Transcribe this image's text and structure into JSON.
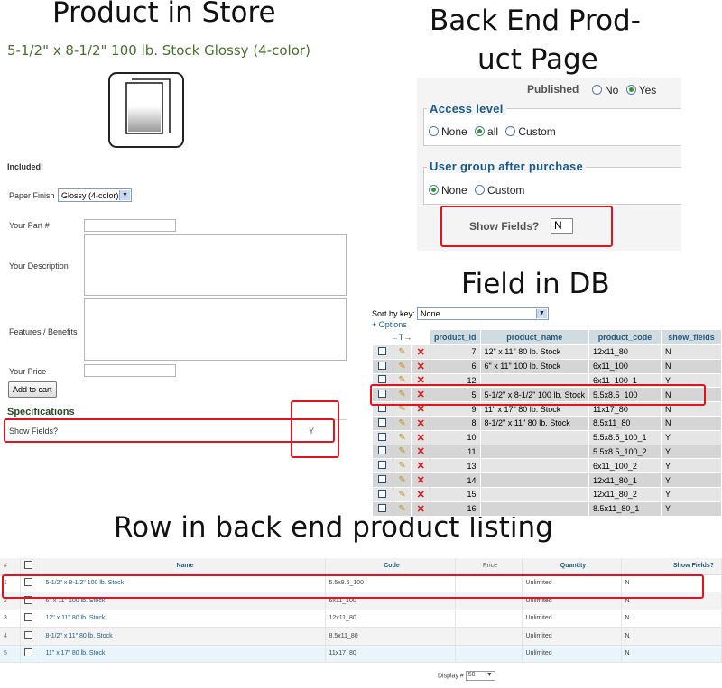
{
  "headings": {
    "store": "Product in Store",
    "backend_line1": "Back End Prod-",
    "backend_line2": "uct Page",
    "db": "Field in DB",
    "listing": "Row in back end product listing"
  },
  "store": {
    "product_title": "5-1/2\" x 8-1/2\" 100 lb. Stock Glossy (4-color)",
    "included": "Included!",
    "paper_finish_label": "Paper Finish",
    "paper_finish_value": "Glossy (4-color)",
    "part_label": "Your Part #",
    "description_label": "Your Description",
    "features_label": "Features / Benefits",
    "price_label": "Your Price",
    "add_to_cart": "Add to cart",
    "specifications": "Specifications",
    "show_fields_label": "Show Fields?",
    "show_fields_value": "Y"
  },
  "backend": {
    "published_label": "Published",
    "no": "No",
    "yes": "Yes",
    "access_level": "Access level",
    "none": "None",
    "all": "all",
    "custom": "Custom",
    "user_group": "User group after purchase",
    "show_fields_label": "Show Fields?",
    "show_fields_value": "N"
  },
  "db": {
    "sort_by_label": "Sort by key:",
    "sort_by_value": "None",
    "options": "+ Options",
    "nav": "←T→",
    "columns": [
      "product_id",
      "product_name",
      "product_code",
      "show_fields"
    ],
    "rows": [
      {
        "id": "7",
        "name": "12\" x 11\" 80 lb. Stock",
        "code": "12x11_80",
        "show": "N"
      },
      {
        "id": "6",
        "name": "6\" x 11\" 100 lb. Stock",
        "code": "6x11_100",
        "show": "N"
      },
      {
        "id": "12",
        "name": "",
        "code": "6x11_100_1",
        "show": "Y"
      },
      {
        "id": "5",
        "name": "5-1/2\" x 8-1/2\" 100 lb. Stock",
        "code": "5.5x8.5_100",
        "show": "N"
      },
      {
        "id": "9",
        "name": "11\" x 17\" 80 lb. Stock",
        "code": "11x17_80",
        "show": "N"
      },
      {
        "id": "8",
        "name": "8-1/2\" x 11\" 80 lb. Stock",
        "code": "8.5x11_80",
        "show": "N"
      },
      {
        "id": "10",
        "name": "",
        "code": "5.5x8.5_100_1",
        "show": "Y"
      },
      {
        "id": "11",
        "name": "",
        "code": "5.5x8.5_100_2",
        "show": "Y"
      },
      {
        "id": "13",
        "name": "",
        "code": "6x11_100_2",
        "show": "Y"
      },
      {
        "id": "14",
        "name": "",
        "code": "12x11_80_1",
        "show": "Y"
      },
      {
        "id": "15",
        "name": "",
        "code": "12x11_80_2",
        "show": "Y"
      },
      {
        "id": "16",
        "name": "",
        "code": "8.5x11_80_1",
        "show": "Y"
      }
    ]
  },
  "listing": {
    "columns": [
      "#",
      "",
      "Name",
      "Code",
      "Price",
      "Quantity",
      "Show Fields?"
    ],
    "rows": [
      {
        "n": "1",
        "name": "5-1/2\" x 8-1/2\" 100 lb. Stock",
        "code": "5.5x8.5_100",
        "price": "",
        "qty": "Unlimited",
        "show": "N"
      },
      {
        "n": "2",
        "name": "6\" x 11\" 100 lb. Stock",
        "code": "6x11_100",
        "price": "",
        "qty": "Unlimited",
        "show": "N"
      },
      {
        "n": "3",
        "name": "12\" x 11\" 80 lb. Stock",
        "code": "12x11_80",
        "price": "",
        "qty": "Unlimited",
        "show": "N"
      },
      {
        "n": "4",
        "name": "8-1/2\" x 11\" 80 lb. Stock",
        "code": "8.5x11_80",
        "price": "",
        "qty": "Unlimited",
        "show": "N"
      },
      {
        "n": "5",
        "name": "11\" x 17\" 80 lb. Stock",
        "code": "11x17_80",
        "price": "",
        "qty": "Unlimited",
        "show": "N"
      }
    ],
    "display_label": "Display #",
    "display_value": "50"
  },
  "colors": {
    "highlight": "#e0141e",
    "link": "#1f5b86",
    "green": "#4b6f2f"
  }
}
